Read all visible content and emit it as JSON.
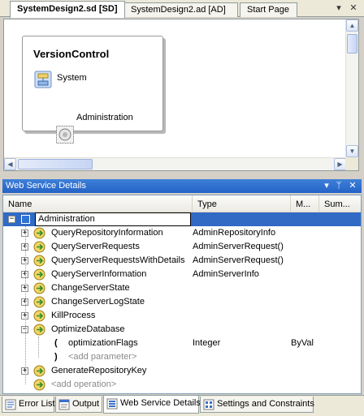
{
  "doc_tabs": [
    {
      "label": "SystemDesign2.sd [SD]",
      "active": true
    },
    {
      "label": "SystemDesign2.ad [AD]",
      "active": false
    },
    {
      "label": "Start Page",
      "active": false
    }
  ],
  "tab_controls": {
    "dropdown": "▾",
    "close": "✕"
  },
  "designer": {
    "system_title": "VersionControl",
    "system_label": "System",
    "endpoint_label": "Administration"
  },
  "tool_window": {
    "title": "Web Service Details",
    "controls": {
      "dropdown": "▾",
      "pin": "ᛘ",
      "close": "✕"
    }
  },
  "grid": {
    "columns": [
      "Name",
      "Type",
      "M...",
      "Sum..."
    ],
    "rows": [
      {
        "kind": "root",
        "name": "Administration",
        "type": "",
        "modifier": "",
        "expander": "−"
      },
      {
        "kind": "op",
        "name": "QueryRepositoryInformation",
        "type": "AdminRepositoryInfo",
        "modifier": "",
        "expander": "+"
      },
      {
        "kind": "op",
        "name": "QueryServerRequests",
        "type": "AdminServerRequest()",
        "modifier": "",
        "expander": "+"
      },
      {
        "kind": "op",
        "name": "QueryServerRequestsWithDetails",
        "type": "AdminServerRequest()",
        "modifier": "",
        "expander": "+"
      },
      {
        "kind": "op",
        "name": "QueryServerInformation",
        "type": "AdminServerInfo",
        "modifier": "",
        "expander": "+"
      },
      {
        "kind": "op",
        "name": "ChangeServerState",
        "type": "",
        "modifier": "",
        "expander": "+"
      },
      {
        "kind": "op",
        "name": "ChangeServerLogState",
        "type": "",
        "modifier": "",
        "expander": "+"
      },
      {
        "kind": "op",
        "name": "KillProcess",
        "type": "",
        "modifier": "",
        "expander": "+"
      },
      {
        "kind": "op",
        "name": "OptimizeDatabase",
        "type": "",
        "modifier": "",
        "expander": "−"
      },
      {
        "kind": "param",
        "name": "optimizationFlags",
        "type": "Integer",
        "modifier": "ByVal",
        "bracket": "("
      },
      {
        "kind": "param-add",
        "name": "<add parameter>",
        "type": "",
        "modifier": "",
        "bracket": ")"
      },
      {
        "kind": "op",
        "name": "GenerateRepositoryKey",
        "type": "",
        "modifier": "",
        "expander": "+"
      },
      {
        "kind": "op-add",
        "name": "<add operation>",
        "type": "",
        "modifier": ""
      }
    ]
  },
  "bottom_tabs": [
    {
      "label": "Error List",
      "icon": "error-list-icon",
      "active": false
    },
    {
      "label": "Output",
      "icon": "output-icon",
      "active": false
    },
    {
      "label": "Web Service Details",
      "icon": "web-service-details-icon",
      "active": true
    },
    {
      "label": "Settings and Constraints",
      "icon": "settings-constraints-icon",
      "active": false
    }
  ],
  "colors": {
    "selection": "#316ac5",
    "header_blue": "#2d6bd0",
    "placeholder_text": "#8a8a8a"
  }
}
